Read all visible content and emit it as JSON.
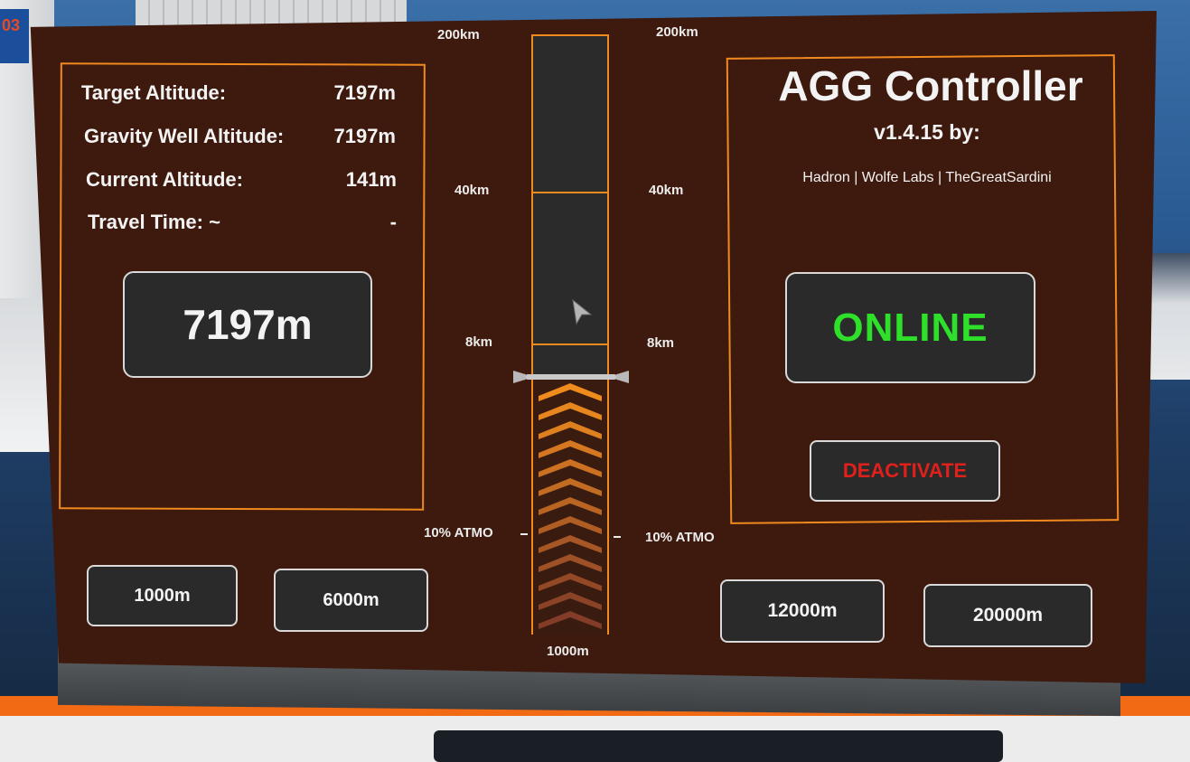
{
  "info": {
    "rows": [
      {
        "label": "Target Altitude:",
        "value": "7197m"
      },
      {
        "label": "Gravity Well Altitude:",
        "value": "7197m"
      },
      {
        "label": "Current Altitude:",
        "value": "141m"
      },
      {
        "label": "Travel Time: ~",
        "value": "-"
      }
    ],
    "display_value": "7197m"
  },
  "presets": {
    "left": [
      "1000m",
      "6000m"
    ],
    "right": [
      "12000m",
      "20000m"
    ]
  },
  "gauge": {
    "labels_left": [
      "200km",
      "40km",
      "8km",
      "10% ATMO"
    ],
    "labels_right": [
      "200km",
      "40km",
      "8km",
      "10% ATMO"
    ],
    "bottom_label": "1000m",
    "chevron_count": 13
  },
  "controller": {
    "title": "AGG Controller",
    "version": "v1.4.15 by:",
    "authors": "Hadron | Wolfe Labs | TheGreatSardini",
    "status": "ONLINE",
    "deactivate_label": "DEACTIVATE"
  },
  "background": {
    "sign_text": "03"
  },
  "colors": {
    "panel_bg": "#3e1a0e",
    "accent": "#f08a1f",
    "online": "#2fe02b",
    "deactivate": "#e0201a"
  }
}
